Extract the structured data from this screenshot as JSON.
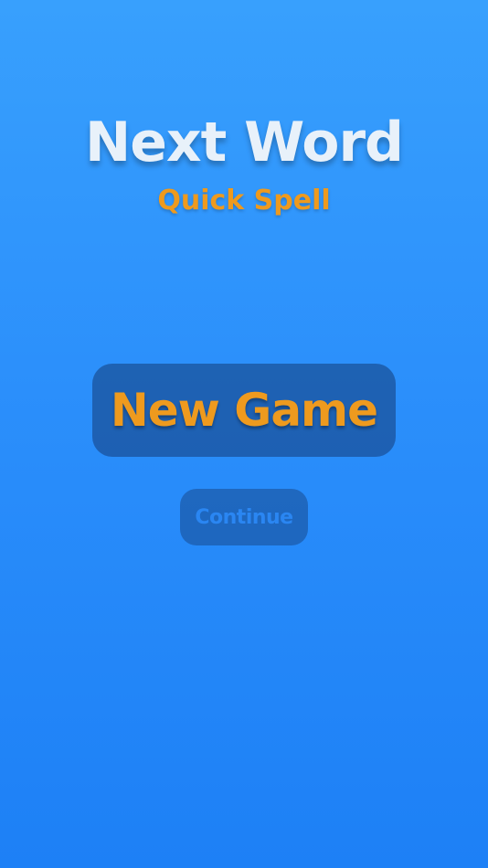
{
  "title": {
    "main": "Next Word",
    "subtitle": "Quick Spell"
  },
  "menu": {
    "new_game_label": "New Game",
    "continue_label": "Continue"
  },
  "colors": {
    "background_top": "#38a0fd",
    "background_bottom": "#1d80f6",
    "title_text": "#e8f1fa",
    "accent_orange": "#ee9a1e",
    "continue_text": "#2a86f2"
  }
}
